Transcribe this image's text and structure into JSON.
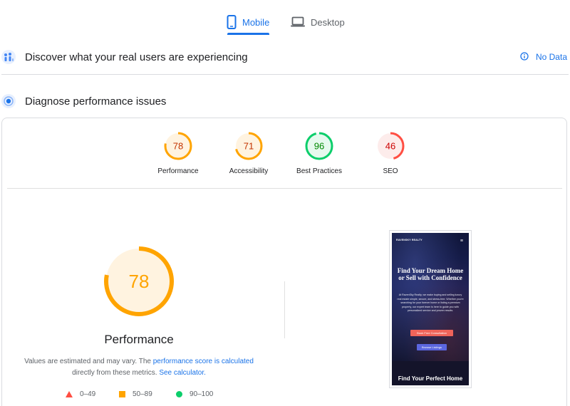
{
  "tabs": {
    "mobile": "Mobile",
    "desktop": "Desktop",
    "active": "mobile"
  },
  "field_data": {
    "title": "Discover what your real users are experiencing",
    "no_data": "No Data"
  },
  "lab": {
    "title": "Diagnose performance issues"
  },
  "scores": [
    {
      "label": "Performance",
      "value": 78,
      "status": "average",
      "color": "#ffa400"
    },
    {
      "label": "Accessibility",
      "value": 71,
      "status": "average",
      "color": "#ffa400"
    },
    {
      "label": "Best Practices",
      "value": 96,
      "status": "pass",
      "color": "#0cce6b"
    },
    {
      "label": "SEO",
      "value": 46,
      "status": "fail",
      "color": "#ff4e42"
    }
  ],
  "main_score": {
    "label": "Performance",
    "value": 78,
    "color": "#ffa400"
  },
  "note": {
    "text1": "Values are estimated and may vary. The",
    "link1": "performance score is calculated",
    "text2": "directly from these metrics.",
    "link2": "See calculator."
  },
  "legend": {
    "fail": "0–49",
    "average": "50–89",
    "pass": "90–100"
  },
  "screenshot": {
    "logo": "RAVENSKY REALTY",
    "heading": "Find Your Dream Home or Sell with Confidence",
    "body": "At RavenSky Realty, we make buying and selling luxury real estate simple, secure, and stress-free. Whether you're searching for your forever home or listing a premium property, our expert team is here to guide you with personalized service and proven results.",
    "button_primary": "Book Free Consultation",
    "button_secondary": "Browse Listings",
    "bottom_heading": "Find Your Perfect Home"
  },
  "colors": {
    "accent": "#1a73e8",
    "average": "#ffa400",
    "pass": "#0cce6b",
    "fail": "#ff4e42"
  }
}
